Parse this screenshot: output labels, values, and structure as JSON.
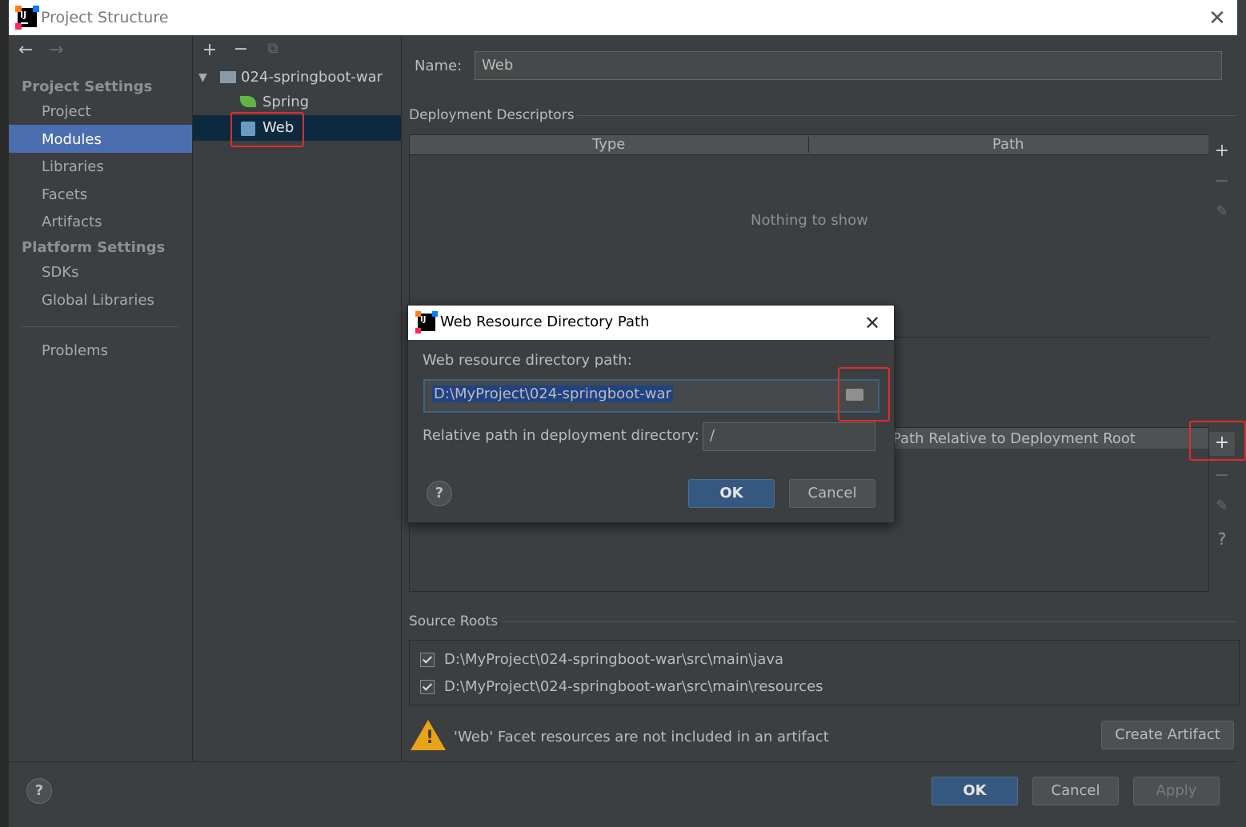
{
  "window": {
    "title": "Project Structure"
  },
  "sidebar": {
    "project_settings_header": "Project Settings",
    "items": [
      {
        "label": "Project"
      },
      {
        "label": "Modules"
      },
      {
        "label": "Libraries"
      },
      {
        "label": "Facets"
      },
      {
        "label": "Artifacts"
      }
    ],
    "platform_settings_header": "Platform Settings",
    "platform_items": [
      {
        "label": "SDKs"
      },
      {
        "label": "Global Libraries"
      }
    ],
    "problems_label": "Problems",
    "selected": "Modules"
  },
  "tree": {
    "root": "024-springboot-war",
    "children": [
      {
        "label": "Spring",
        "icon": "spring-leaf-icon"
      },
      {
        "label": "Web",
        "icon": "web-facet-icon"
      }
    ],
    "selected": "Web"
  },
  "facet": {
    "name_label": "Name:",
    "name_value": "Web",
    "deployment_descriptors_title": "Deployment Descriptors",
    "dd_columns": [
      "Type",
      "Path"
    ],
    "dd_empty": "Nothing to show",
    "web_resource_column": "Path Relative to Deployment Root",
    "source_roots_title": "Source Roots",
    "source_roots": [
      {
        "path": "D:\\MyProject\\024-springboot-war\\src\\main\\java",
        "checked": true
      },
      {
        "path": "D:\\MyProject\\024-springboot-war\\src\\main\\resources",
        "checked": true
      }
    ],
    "warning": "'Web' Facet resources are not included in an artifact",
    "create_artifact": "Create Artifact"
  },
  "footer": {
    "ok": "OK",
    "cancel": "Cancel",
    "apply": "Apply"
  },
  "dialog": {
    "title": "Web Resource Directory Path",
    "path_label": "Web resource directory path:",
    "path_value": "D:\\MyProject\\024-springboot-war",
    "relative_label": "Relative path in deployment directory:",
    "relative_value": "/",
    "ok": "OK",
    "cancel": "Cancel"
  },
  "colors": {
    "accent": "#4b6eaf",
    "primary_button": "#365880",
    "highlight_box": "#e32b2b",
    "warning": "#e8a317"
  }
}
